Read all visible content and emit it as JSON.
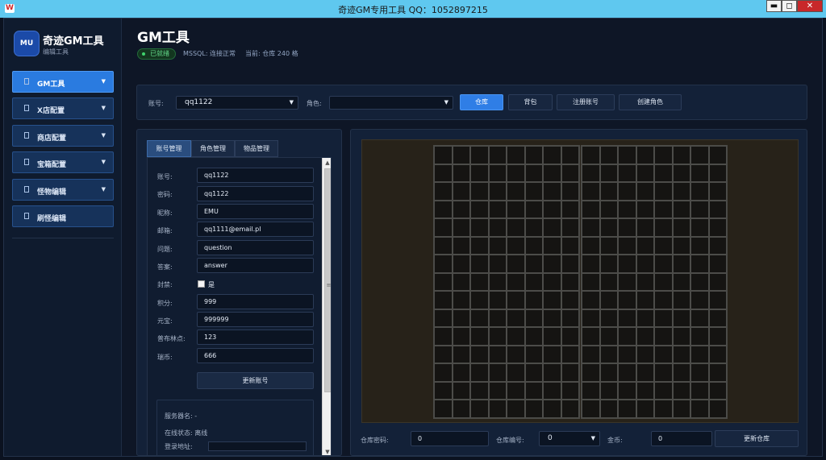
{
  "window": {
    "title": "奇迹GM专用工具 QQ：1052897215",
    "icon_text": "W",
    "controls": {
      "minimize": "▬",
      "maximize": "◻",
      "close": "✕"
    }
  },
  "sidebar": {
    "logo": "MU",
    "brand_title": "奇迹GM工具",
    "brand_subtitle": "编辑工具",
    "items": [
      {
        "label": "GM工具",
        "has_chevron": true,
        "active": true
      },
      {
        "label": "X店配置",
        "has_chevron": true
      },
      {
        "label": "商店配置",
        "has_chevron": true
      },
      {
        "label": "宝箱配置",
        "has_chevron": true
      },
      {
        "label": "怪物编辑",
        "has_chevron": true
      },
      {
        "label": "刷怪编辑",
        "has_chevron": false
      }
    ],
    "chevron": "▼"
  },
  "header": {
    "title": "GM工具",
    "badge": "已就绪",
    "db_status": "MSSQL: 连接正常",
    "current": "当前: 仓库 240 格"
  },
  "toolbar": {
    "account_label": "账号:",
    "account_value": "qq1122",
    "role_label": "角色:",
    "role_value": "",
    "buttons": [
      "仓库",
      "背包",
      "注册账号",
      "创建角色"
    ]
  },
  "tabs": [
    "账号管理",
    "角色管理",
    "物品管理"
  ],
  "account_form": {
    "fields": [
      {
        "label": "账号:",
        "value": "qq1122"
      },
      {
        "label": "密码:",
        "value": "qq1122"
      },
      {
        "label": "昵称:",
        "value": "EMU"
      },
      {
        "label": "邮箱:",
        "value": "qq1111@email.pl"
      },
      {
        "label": "问题:",
        "value": "question"
      },
      {
        "label": "答案:",
        "value": "answer"
      }
    ],
    "ban_label": "封禁:",
    "ban_checkbox_label": "是",
    "ban_checked": false,
    "fields2": [
      {
        "label": "积分:",
        "value": "999"
      },
      {
        "label": "元宝:",
        "value": "999999"
      },
      {
        "label": "普布林点:",
        "value": "123"
      },
      {
        "label": "瑞币:",
        "value": "666"
      }
    ],
    "update_button": "更新账号",
    "server_name": "服务器名: -",
    "online_status": "在线状态: 离线",
    "login_address": "登录地址:"
  },
  "warehouse": {
    "password_label": "仓库密码:",
    "password_value": "0",
    "number_label": "仓库编号:",
    "number_value": "0",
    "zen_label": "金币:",
    "zen_value": "0",
    "update_button": "更新仓库"
  }
}
